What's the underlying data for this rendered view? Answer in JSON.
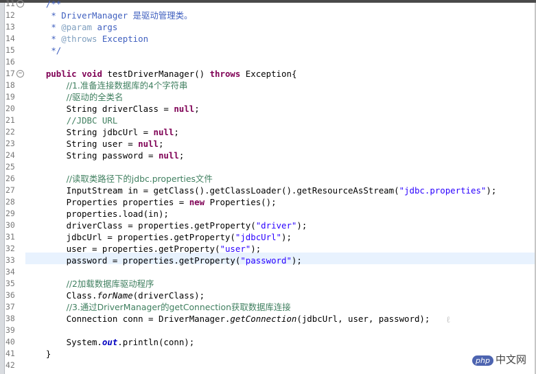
{
  "editor": {
    "lines": [
      {
        "num": "11",
        "fold": true,
        "tokens": [
          {
            "t": "    "
          },
          {
            "t": "/**",
            "c": "jd"
          }
        ]
      },
      {
        "num": "12",
        "tokens": [
          {
            "t": "     "
          },
          {
            "t": "* DriverManager ",
            "c": "jd"
          },
          {
            "t": "是驱动管理类。",
            "c": "jd cjk",
            "k": "cjk"
          }
        ]
      },
      {
        "num": "13",
        "tokens": [
          {
            "t": "     "
          },
          {
            "t": "* ",
            "c": "jd"
          },
          {
            "t": "@param",
            "c": "jdt"
          },
          {
            "t": " args",
            "c": "jd"
          }
        ]
      },
      {
        "num": "14",
        "tokens": [
          {
            "t": "     "
          },
          {
            "t": "* ",
            "c": "jd"
          },
          {
            "t": "@throws",
            "c": "jdt"
          },
          {
            "t": " Exception",
            "c": "jd"
          }
        ]
      },
      {
        "num": "15",
        "tokens": [
          {
            "t": "     "
          },
          {
            "t": "*/",
            "c": "jd"
          }
        ]
      },
      {
        "num": "16",
        "tokens": []
      },
      {
        "num": "17",
        "fold": true,
        "tokens": [
          {
            "t": "    "
          },
          {
            "t": "public",
            "c": "kw"
          },
          {
            "t": " "
          },
          {
            "t": "void",
            "c": "kw"
          },
          {
            "t": " testDriverManager() "
          },
          {
            "t": "throws",
            "c": "kw"
          },
          {
            "t": " Exception{"
          }
        ]
      },
      {
        "num": "18",
        "tokens": [
          {
            "t": "        "
          },
          {
            "t": "//1.准备连接数据库的4个字符串",
            "c": "cm",
            "k": "cjk"
          }
        ]
      },
      {
        "num": "19",
        "tokens": [
          {
            "t": "        "
          },
          {
            "t": "//驱动的全类名",
            "c": "cm",
            "k": "cjk"
          }
        ]
      },
      {
        "num": "20",
        "tokens": [
          {
            "t": "        String driverClass = "
          },
          {
            "t": "null",
            "c": "kw"
          },
          {
            "t": ";"
          }
        ]
      },
      {
        "num": "21",
        "tokens": [
          {
            "t": "        "
          },
          {
            "t": "//JDBC URL",
            "c": "cm"
          }
        ]
      },
      {
        "num": "22",
        "tokens": [
          {
            "t": "        String jdbcUrl = "
          },
          {
            "t": "null",
            "c": "kw"
          },
          {
            "t": ";"
          }
        ]
      },
      {
        "num": "23",
        "tokens": [
          {
            "t": "        String user = "
          },
          {
            "t": "null",
            "c": "kw"
          },
          {
            "t": ";"
          }
        ]
      },
      {
        "num": "24",
        "tokens": [
          {
            "t": "        String password = "
          },
          {
            "t": "null",
            "c": "kw"
          },
          {
            "t": ";"
          }
        ]
      },
      {
        "num": "25",
        "tokens": []
      },
      {
        "num": "26",
        "tokens": [
          {
            "t": "        "
          },
          {
            "t": "//读取类路径下的jdbc.properties文件",
            "c": "cm",
            "k": "cjk"
          }
        ]
      },
      {
        "num": "27",
        "tokens": [
          {
            "t": "        InputStream in = getClass().getClassLoader().getResourceAsStream("
          },
          {
            "t": "\"jdbc.properties\"",
            "c": "str"
          },
          {
            "t": ");"
          }
        ]
      },
      {
        "num": "28",
        "tokens": [
          {
            "t": "        Properties properties = "
          },
          {
            "t": "new",
            "c": "kw"
          },
          {
            "t": " Properties();"
          }
        ]
      },
      {
        "num": "29",
        "tokens": [
          {
            "t": "        properties.load(in);"
          }
        ]
      },
      {
        "num": "30",
        "tokens": [
          {
            "t": "        driverClass = properties.getProperty("
          },
          {
            "t": "\"driver\"",
            "c": "str"
          },
          {
            "t": ");"
          }
        ]
      },
      {
        "num": "31",
        "tokens": [
          {
            "t": "        jdbcUrl = properties.getProperty("
          },
          {
            "t": "\"jdbcUrl\"",
            "c": "str"
          },
          {
            "t": ");"
          }
        ]
      },
      {
        "num": "32",
        "tokens": [
          {
            "t": "        user = properties.getProperty("
          },
          {
            "t": "\"user\"",
            "c": "str"
          },
          {
            "t": ");"
          }
        ]
      },
      {
        "num": "33",
        "tokens": [
          {
            "t": "        password = properties.getProperty("
          },
          {
            "t": "\"password\"",
            "c": "str"
          },
          {
            "t": ");"
          }
        ]
      },
      {
        "num": "34",
        "tokens": []
      },
      {
        "num": "35",
        "tokens": [
          {
            "t": "        "
          },
          {
            "t": "//2加载数据库驱动程序",
            "c": "cm",
            "k": "cjk"
          }
        ]
      },
      {
        "num": "36",
        "tokens": [
          {
            "t": "        Class."
          },
          {
            "t": "forName",
            "c": "it"
          },
          {
            "t": "(driverClass);"
          }
        ]
      },
      {
        "num": "37",
        "tokens": [
          {
            "t": "        "
          },
          {
            "t": "//3.通过DriverManager的getConnection获取数据库连接",
            "c": "cm",
            "k": "cjk"
          }
        ]
      },
      {
        "num": "38",
        "tokens": [
          {
            "t": "        Connection conn = DriverManager."
          },
          {
            "t": "getConnection",
            "c": "it"
          },
          {
            "t": "(jdbcUrl, user, password);"
          }
        ]
      },
      {
        "num": "39",
        "tokens": []
      },
      {
        "num": "40",
        "tokens": [
          {
            "t": "        System."
          },
          {
            "t": "out",
            "c": "fld-b it"
          },
          {
            "t": ".println(conn);"
          }
        ]
      },
      {
        "num": "41",
        "tokens": [
          {
            "t": "    }"
          }
        ]
      },
      {
        "num": "42",
        "tokens": []
      }
    ],
    "current_line": "32"
  },
  "watermark": {
    "badge": "php",
    "text": "中文网"
  }
}
